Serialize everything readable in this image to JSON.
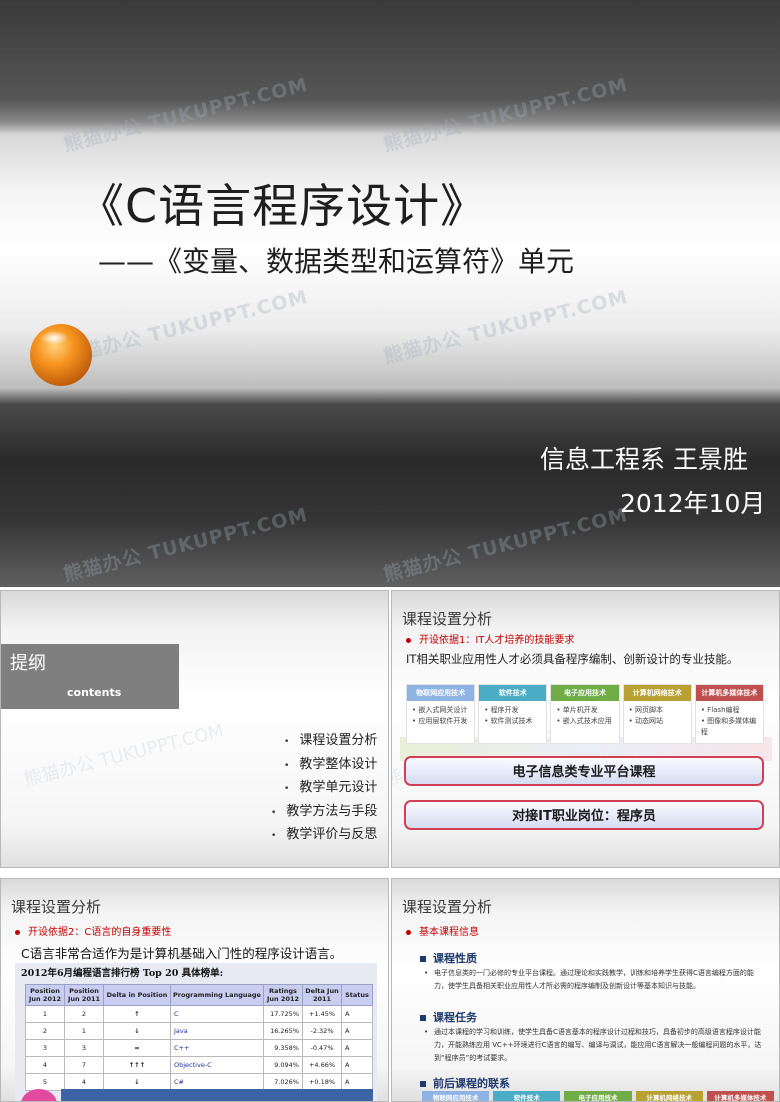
{
  "title_slide": {
    "title": "《C语言程序设计》",
    "subtitle": "——《变量、数据类型和运算符》单元",
    "author": "信息工程系  王景胜",
    "date": "2012年10月",
    "watermark": "熊猫办公 TUKUPPT.COM"
  },
  "toc_slide": {
    "heading": "提纲",
    "heading_en": "contents",
    "items": [
      "课程设置分析",
      "教学整体设计",
      "教学单元设计",
      "教学方法与手段",
      "教学评价与反思"
    ]
  },
  "skills_slide": {
    "title": "课程设置分析",
    "basis": "开设依据1：IT人才培养的技能要求",
    "line": "IT相关职业应用性人才必须具备程序编制、创新设计的专业技能。",
    "columns": [
      {
        "header": "物联网应用技术",
        "items": [
          "嵌入式网关设计",
          "应用层软件开发"
        ],
        "color": "#8eb4e3"
      },
      {
        "header": "软件技术",
        "items": [
          "程序开发",
          "软件测试技术"
        ],
        "color": "#4bacc6"
      },
      {
        "header": "电子应用技术",
        "items": [
          "单片机开发",
          "嵌入式技术应用"
        ],
        "color": "#70ad47"
      },
      {
        "header": "计算机网络技术",
        "items": [
          "网页脚本",
          "动态网站"
        ],
        "color": "#b8a032"
      },
      {
        "header": "计算机多媒体技术",
        "items": [
          "Flash编程",
          "图像和多媒体编程"
        ],
        "color": "#c0504d"
      }
    ],
    "platform": "电子信息类专业平台课程",
    "job": "对接IT职业岗位：程序员"
  },
  "ranking_slide": {
    "title": "课程设置分析",
    "basis": "开设依据2：C语言的自身重要性",
    "line": "C语言非常合适作为是计算机基础入门性的程序设计语言。",
    "table_title": "2012年6月编程语言排行榜   Top 20 具体榜单:",
    "headers": [
      "Position Jun 2012",
      "Position Jun 2011",
      "Delta in Position",
      "Programming Language",
      "Ratings Jun 2012",
      "Delta Jun 2011",
      "Status"
    ],
    "rows": [
      {
        "pos": "1",
        "prev": "2",
        "delta": "↑",
        "delta_kind": "up",
        "lang": "C",
        "rating": "17.725%",
        "change": "+1.45%",
        "status": "A"
      },
      {
        "pos": "2",
        "prev": "1",
        "delta": "↓",
        "delta_kind": "down",
        "lang": "Java",
        "rating": "16.265%",
        "change": "-2.32%",
        "status": "A"
      },
      {
        "pos": "3",
        "prev": "3",
        "delta": "=",
        "delta_kind": "eq",
        "lang": "C++",
        "rating": "9.358%",
        "change": "-0.47%",
        "status": "A"
      },
      {
        "pos": "4",
        "prev": "7",
        "delta": "↑↑↑",
        "delta_kind": "up",
        "lang": "Objective-C",
        "rating": "9.094%",
        "change": "+4.66%",
        "status": "A"
      },
      {
        "pos": "5",
        "prev": "4",
        "delta": "↓",
        "delta_kind": "down",
        "lang": "C#",
        "rating": "7.026%",
        "change": "+0.18%",
        "status": "A"
      }
    ]
  },
  "info_slide": {
    "title": "课程设置分析",
    "basis": "基本课程信息",
    "nature_heading": "课程性质",
    "nature_text": "电子信息类的一门必修的专业平台课程。通过理论和实践教学，训练和培养学生获得C语言编程方面的能力，使学生具备相关职业应用性人才所必需的程序编制及创新设计等基本知识与技能。",
    "task_heading": "课程任务",
    "task_text": "通过本课程的学习和训练，使学生具备C语言基本的程序设计过程和技巧，具备初步的高级语言程序设计能力，开能熟练应用 VC++环境进行C语言的编写、编译与调试，能应用C语言解决一般编程问题的水平，达到“程序员”的考试要求。",
    "relation_heading": "前后课程的联系",
    "tabs": [
      "物联网应用技术",
      "软件技术",
      "电子应用技术",
      "计算机网络技术",
      "计算机多媒体技术"
    ]
  }
}
